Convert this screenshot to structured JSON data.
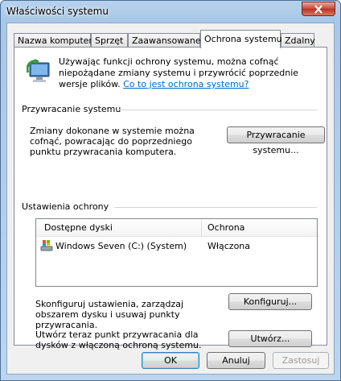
{
  "window": {
    "title": "Właściwości systemu"
  },
  "tabs": [
    {
      "label": "Nazwa komputera"
    },
    {
      "label": "Sprzęt"
    },
    {
      "label": "Zaawansowane"
    },
    {
      "label": "Ochrona systemu"
    },
    {
      "label": "Zdalny"
    }
  ],
  "active_tab": "Ochrona systemu",
  "info": {
    "text": "Używając funkcji ochrony systemu, można cofnąć niepożądane zmiany systemu i przywrócić poprzednie wersje plików.",
    "link": "Co to jest ochrona systemu?"
  },
  "restore_group": {
    "heading": "Przywracanie systemu",
    "description": "Zmiany dokonane w systemie można cofnąć, powracając do poprzedniego punktu przywracania komputera.",
    "button": "Przywracanie systemu..."
  },
  "protection_group": {
    "heading": "Ustawienia ochrony",
    "columns": [
      "Dostępne dyski",
      "Ochrona"
    ],
    "rows": [
      {
        "drive": "Windows Seven (C:) (System)",
        "protection": "Włączona"
      }
    ],
    "configure_text": "Skonfiguruj ustawienia, zarządzaj obszarem dysku i usuwaj punkty przywracania.",
    "configure_button": "Konfiguruj...",
    "create_text": "Utwórz teraz punkt przywracania dla dysków z włączoną ochroną systemu.",
    "create_button": "Utwórz..."
  },
  "dialog_buttons": {
    "ok": "OK",
    "cancel": "Anuluj",
    "apply": "Zastosuj"
  }
}
